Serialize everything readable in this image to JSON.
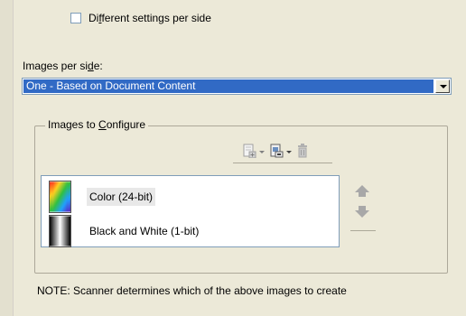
{
  "checkbox": {
    "label_pre": "Di",
    "label_accel": "f",
    "label_post": "ferent settings per side",
    "checked": false
  },
  "images_per_side": {
    "label_pre": "Images per si",
    "label_accel": "d",
    "label_post": "e:",
    "selected": "One - Based on Document Content"
  },
  "group": {
    "title_pre": "Images to ",
    "title_accel": "C",
    "title_post": "onfigure"
  },
  "toolbar": {
    "icons": [
      "add-image-icon",
      "copy-image-icon",
      "delete-icon"
    ]
  },
  "list": {
    "items": [
      {
        "label": "Color (24-bit)",
        "icon": "color-image-icon",
        "selected": true
      },
      {
        "label": "Black and White (1-bit)",
        "icon": "bw-image-icon",
        "selected": false
      }
    ]
  },
  "side_buttons": [
    "move-up-icon",
    "move-down-icon"
  ],
  "note": "NOTE: Scanner determines which of the above images to create",
  "colors": {
    "selection": "#316ac5",
    "panel": "#ece9d8",
    "disabled": "#a8a8a8"
  }
}
